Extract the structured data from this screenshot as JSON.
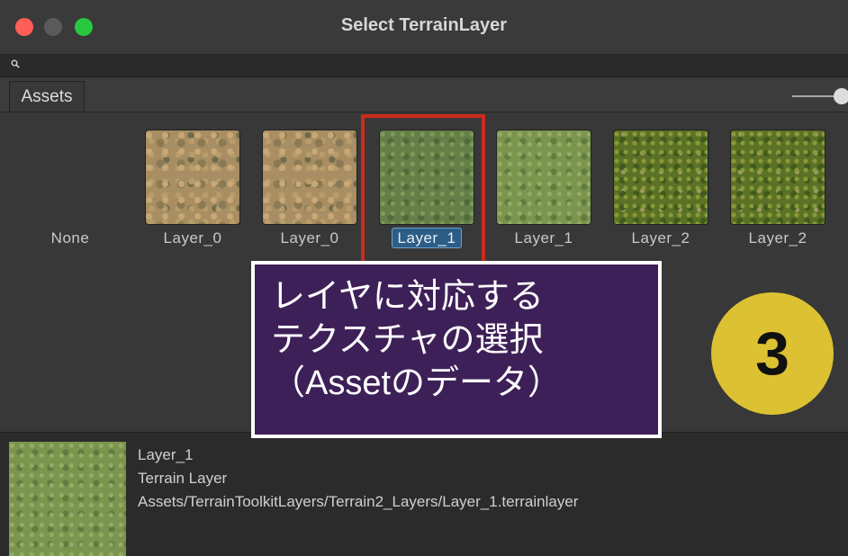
{
  "window": {
    "title": "Select TerrainLayer"
  },
  "search": {
    "value": "",
    "placeholder": ""
  },
  "tabs": [
    {
      "label": "Assets"
    }
  ],
  "grid": {
    "items": [
      {
        "label": "None",
        "texture": "none",
        "selected": false
      },
      {
        "label": "Layer_0",
        "texture": "dirt",
        "selected": false
      },
      {
        "label": "Layer_0",
        "texture": "dirt",
        "selected": false
      },
      {
        "label": "Layer_1",
        "texture": "grass-1",
        "selected": true
      },
      {
        "label": "Layer_1",
        "texture": "grass-1-light",
        "selected": false
      },
      {
        "label": "Layer_2",
        "texture": "grass-2",
        "selected": false
      },
      {
        "label": "Layer_2",
        "texture": "grass-2",
        "selected": false
      }
    ]
  },
  "annotation": {
    "lines": [
      "レイヤに対応する",
      "テクスチャの選択",
      "（Assetのデータ）"
    ],
    "badge": "3",
    "highlight_color": "#cc2a1c",
    "box_color": "#3e2058",
    "badge_color": "#dcc133"
  },
  "preview": {
    "name": "Layer_1",
    "type": "Terrain Layer",
    "path": "Assets/TerrainToolkitLayers/Terrain2_Layers/Layer_1.terrainlayer"
  }
}
